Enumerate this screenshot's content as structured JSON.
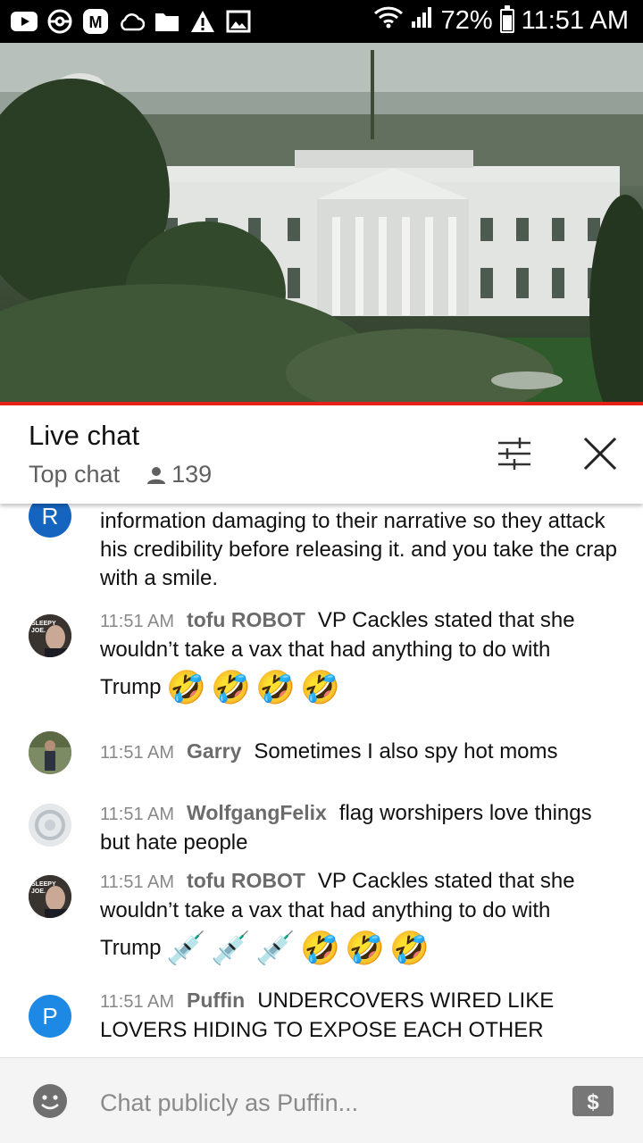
{
  "status_bar": {
    "battery": "72%",
    "time": "11:51 AM",
    "icons": [
      "youtube-icon",
      "pokemon-icon",
      "m-app-icon",
      "cloud-icon",
      "folder-icon",
      "warning-icon",
      "image-icon",
      "wifi-icon",
      "signal-icon",
      "battery-icon"
    ]
  },
  "header": {
    "title": "Live chat",
    "mode": "Top chat",
    "viewer_count": "139",
    "icons": [
      "filter-icon",
      "close-icon"
    ]
  },
  "messages": [
    {
      "avatar_letter": "R",
      "avatar_color": "#1565c0",
      "time": "",
      "author": "",
      "text": "information damaging to their narrative so they attack his credibility before releasing it. and you take the crap with a smile.",
      "emojis": []
    },
    {
      "avatar_label": "SLEEPY JOE.",
      "time": "11:51 AM",
      "author": "tofu ROBOT",
      "text": "VP Cackles stated that she wouldn’t take a vax that had anything to do with",
      "tail": "Trump",
      "emojis": [
        "🤣",
        "🤣",
        "🤣",
        "🤣"
      ]
    },
    {
      "time": "11:51 AM",
      "author": "Garry",
      "text": "Sometimes I also spy hot moms",
      "emojis": []
    },
    {
      "time": "11:51 AM",
      "author": "WolfgangFelix",
      "text": "flag worshipers love things but hate people",
      "emojis": []
    },
    {
      "avatar_label": "SLEEPY JOE.",
      "time": "11:51 AM",
      "author": "tofu ROBOT",
      "text": "VP Cackles stated that she wouldn’t take a vax that had anything to do with",
      "tail": "Trump",
      "emojis": [
        "💉",
        "💉",
        "💉",
        "🤣",
        "🤣",
        "🤣"
      ]
    },
    {
      "avatar_letter": "P",
      "avatar_color": "#1e88e5",
      "time": "11:51 AM",
      "author": "Puffin",
      "text": "UNDERCOVERS WIRED LIKE LOVERS HIDING TO EXPOSE EACH OTHER",
      "emojis": []
    }
  ],
  "footer": {
    "placeholder": "Chat publicly as Puffin...",
    "icons": [
      "emoji-icon",
      "super-chat-icon"
    ]
  }
}
